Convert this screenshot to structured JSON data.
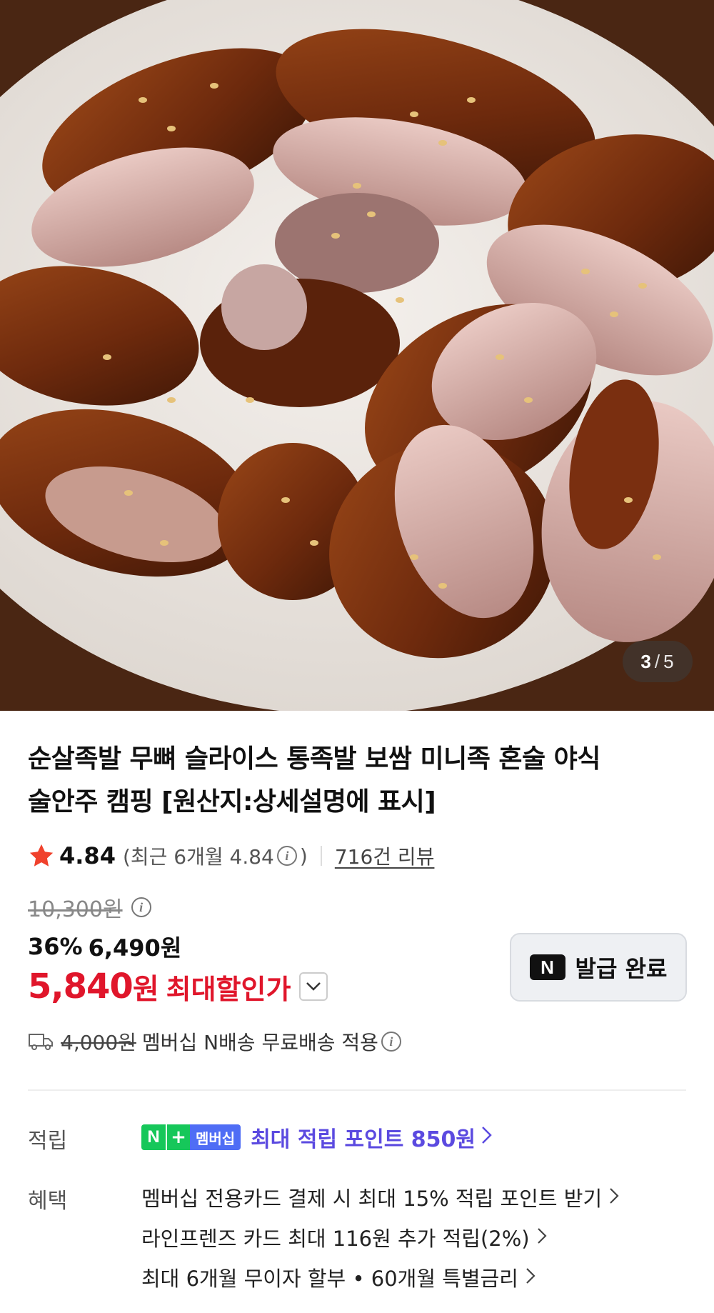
{
  "gallery": {
    "current": "3",
    "separator": "/",
    "total": "5"
  },
  "product": {
    "title_line1": "순살족발 무뼈 슬라이스 통족발 보쌈 미니족 혼술 야식",
    "title_line2": "술안주 캠핑 [원산지:상세설명에 표시]"
  },
  "rating": {
    "score": "4.84",
    "recent_prefix": "(최근 6개월 4.84",
    "recent_suffix": ")",
    "review_count": "716건 리뷰"
  },
  "price": {
    "original": "10,300원",
    "discount_rate": "36%",
    "sale": "6,490원",
    "max_value": "5,840",
    "max_unit": "원",
    "max_label": "최대할인가"
  },
  "coupon": {
    "badge": "N",
    "label": "발급 완료"
  },
  "shipping": {
    "old_fee": "4,000원",
    "text": "멤버십 N배송 무료배송 적용"
  },
  "points": {
    "label": "적립",
    "badge_n": "N",
    "badge_plus": "+",
    "badge_text": "멤버십",
    "text": "최대 적립 포인트 850원"
  },
  "benefits": {
    "label": "혜택",
    "items": [
      "멤버십 전용카드 결제 시 최대 15% 적립 포인트 받기",
      "라인프렌즈 카드 최대 116원 추가 적립(2%)",
      "최대 6개월 무이자 할부 • 60개월 특별금리"
    ]
  },
  "colors": {
    "accent_red": "#e0162b",
    "point_purple": "#5b4ae0",
    "badge_green": "#16c75a",
    "badge_blue": "#4f6df5",
    "star": "#f0412c"
  },
  "icons": {
    "star": "star-icon",
    "info": "info-icon",
    "truck": "truck-icon",
    "chevron_down": "chevron-down-icon",
    "chevron_right": "chevron-right-icon"
  }
}
